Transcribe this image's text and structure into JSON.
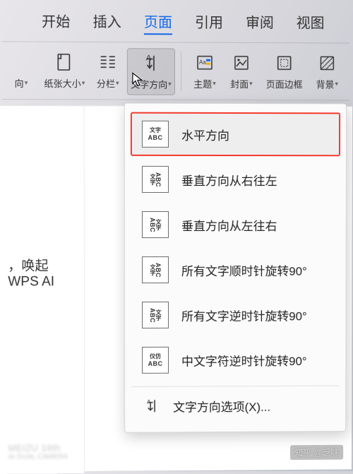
{
  "tabs": {
    "items": [
      "开始",
      "插入",
      "页面",
      "引用",
      "审阅",
      "视图"
    ],
    "active_index": 2
  },
  "toolbar": {
    "orientation_partial": "向",
    "paper_size": "纸张大小",
    "columns": "分栏",
    "text_direction": "文字方向",
    "theme": "主题",
    "cover": "封面",
    "page_border": "页面边框",
    "background": "背景"
  },
  "menu": {
    "items": [
      {
        "thumb_top": "文字",
        "thumb_bottom": "ABC",
        "label": "水平方向",
        "highlight": true
      },
      {
        "thumb_top": "文字",
        "thumb_bottom": "ABC",
        "label": "垂直方向从右往左",
        "vert": true
      },
      {
        "thumb_top": "文字",
        "thumb_bottom": "ABC",
        "label": "垂直方向从左往右",
        "vert": true
      },
      {
        "thumb_top": "文字",
        "thumb_bottom": "ABC",
        "label": "所有文字顺时针旋转90°",
        "vert": true
      },
      {
        "thumb_top": "文字",
        "thumb_bottom": "ABC",
        "label": "所有文字逆时针旋转90°",
        "vert": true
      },
      {
        "thumb_top": "仪仿",
        "thumb_bottom": "ABC",
        "label": "中文字符逆时针旋转90°"
      }
    ],
    "options_label": "文字方向选项(X)..."
  },
  "canvas_text": "，唤起WPS AI",
  "watermark": {
    "brand": "MEIZU 16th",
    "sub": "AI DUAL CAMERA",
    "zhihu": "知乎 @乏味"
  }
}
